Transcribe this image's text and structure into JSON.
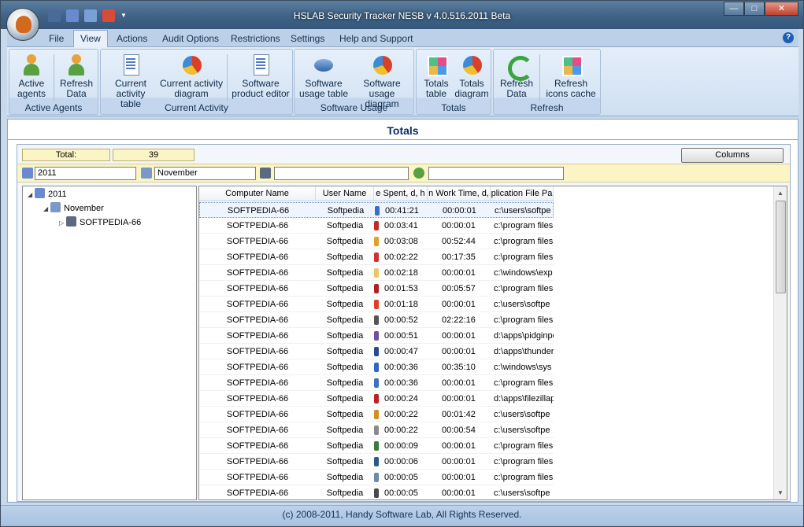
{
  "window": {
    "title": "HSLAB Security Tracker NESB v 4.0.516.2011 Beta"
  },
  "menu": {
    "tabs": [
      "File",
      "View",
      "Actions",
      "Audit Options",
      "Restrictions",
      "Settings",
      "Help and Support"
    ],
    "active_tab": "View",
    "help_icon": "?"
  },
  "ribbon": {
    "groups": [
      {
        "label": "Active Agents",
        "buttons": [
          {
            "line1": "Active",
            "line2": "agents",
            "icon": "agents-icon"
          },
          {
            "line1": "Refresh",
            "line2": "Data",
            "icon": "refresh-agents-icon"
          }
        ]
      },
      {
        "label": "Current Activity",
        "buttons": [
          {
            "line1": "Current",
            "line2": "activity table",
            "icon": "activity-table-icon"
          },
          {
            "line1": "Current activity",
            "line2": "diagram",
            "icon": "activity-diagram-icon"
          },
          {
            "line1": "Software",
            "line2": "product editor",
            "icon": "product-editor-icon"
          }
        ]
      },
      {
        "label": "Software Usage",
        "buttons": [
          {
            "line1": "Software",
            "line2": "usage table",
            "icon": "usage-table-icon"
          },
          {
            "line1": "Software",
            "line2": "usage diagram",
            "icon": "usage-diagram-icon"
          }
        ]
      },
      {
        "label": "Totals",
        "buttons": [
          {
            "line1": "Totals",
            "line2": "table",
            "icon": "totals-table-icon"
          },
          {
            "line1": "Totals",
            "line2": "diagram",
            "icon": "totals-diagram-icon"
          }
        ]
      },
      {
        "label": "Refresh",
        "buttons": [
          {
            "line1": "Refresh",
            "line2": "Data",
            "icon": "refresh-data-icon"
          },
          {
            "line1": "Refresh",
            "line2": "icons cache",
            "icon": "icons-cache-icon"
          }
        ]
      }
    ]
  },
  "totals": {
    "section_title": "Totals",
    "total_label": "Total:",
    "total_value": "39",
    "columns_button": "Columns",
    "filters": {
      "year": "2011",
      "month": "November",
      "computer": "",
      "user": ""
    }
  },
  "tree": {
    "nodes": [
      {
        "label": "2011",
        "icon": "year-icon"
      },
      {
        "label": "November",
        "icon": "month-icon"
      },
      {
        "label": "SOFTPEDIA-66",
        "icon": "computer-icon"
      }
    ]
  },
  "table": {
    "columns": [
      "Computer Name",
      "User Name",
      "e Spent, d, h",
      "n Work Time, d,",
      "plication File Pa"
    ],
    "rows": [
      {
        "computer": "SOFTPEDIA-66",
        "user": "Softpedia",
        "spent": "00:41:21",
        "work": "00:00:01",
        "path": "c:\\users\\softpe",
        "color": "#3c6fc4"
      },
      {
        "computer": "SOFTPEDIA-66",
        "user": "Softpedia",
        "spent": "00:03:41",
        "work": "00:00:01",
        "path": "c:\\program files",
        "color": "#c42a2a"
      },
      {
        "computer": "SOFTPEDIA-66",
        "user": "Softpedia",
        "spent": "00:03:08",
        "work": "00:52:44",
        "path": "c:\\program files",
        "color": "#e0a020"
      },
      {
        "computer": "SOFTPEDIA-66",
        "user": "Softpedia",
        "spent": "00:02:22",
        "work": "00:17:35",
        "path": "c:\\program files",
        "color": "#d03030"
      },
      {
        "computer": "SOFTPEDIA-66",
        "user": "Softpedia",
        "spent": "00:02:18",
        "work": "00:00:01",
        "path": "c:\\windows\\exp",
        "color": "#e8c860"
      },
      {
        "computer": "SOFTPEDIA-66",
        "user": "Softpedia",
        "spent": "00:01:53",
        "work": "00:05:57",
        "path": "c:\\program files",
        "color": "#b02020"
      },
      {
        "computer": "SOFTPEDIA-66",
        "user": "Softpedia",
        "spent": "00:01:18",
        "work": "00:00:01",
        "path": "c:\\users\\softpe",
        "color": "#e04020"
      },
      {
        "computer": "SOFTPEDIA-66",
        "user": "Softpedia",
        "spent": "00:00:52",
        "work": "02:22:16",
        "path": "c:\\program files",
        "color": "#555555"
      },
      {
        "computer": "SOFTPEDIA-66",
        "user": "Softpedia",
        "spent": "00:00:51",
        "work": "00:00:01",
        "path": "d:\\apps\\pidginpo",
        "color": "#7050a0"
      },
      {
        "computer": "SOFTPEDIA-66",
        "user": "Softpedia",
        "spent": "00:00:47",
        "work": "00:00:01",
        "path": "d:\\apps\\thunder",
        "color": "#2a4a90"
      },
      {
        "computer": "SOFTPEDIA-66",
        "user": "Softpedia",
        "spent": "00:00:36",
        "work": "00:35:10",
        "path": "c:\\windows\\sys",
        "color": "#2a6ac0"
      },
      {
        "computer": "SOFTPEDIA-66",
        "user": "Softpedia",
        "spent": "00:00:36",
        "work": "00:00:01",
        "path": "c:\\program files",
        "color": "#4070c0"
      },
      {
        "computer": "SOFTPEDIA-66",
        "user": "Softpedia",
        "spent": "00:00:24",
        "work": "00:00:01",
        "path": "d:\\apps\\filezillap",
        "color": "#c02020"
      },
      {
        "computer": "SOFTPEDIA-66",
        "user": "Softpedia",
        "spent": "00:00:22",
        "work": "00:01:42",
        "path": "c:\\users\\softpe",
        "color": "#d09020"
      },
      {
        "computer": "SOFTPEDIA-66",
        "user": "Softpedia",
        "spent": "00:00:22",
        "work": "00:00:54",
        "path": "c:\\users\\softpe",
        "color": "#8a8a8a"
      },
      {
        "computer": "SOFTPEDIA-66",
        "user": "Softpedia",
        "spent": "00:00:09",
        "work": "00:00:01",
        "path": "c:\\program files",
        "color": "#3a7a3a"
      },
      {
        "computer": "SOFTPEDIA-66",
        "user": "Softpedia",
        "spent": "00:00:06",
        "work": "00:00:01",
        "path": "c:\\program files",
        "color": "#2a5a8a"
      },
      {
        "computer": "SOFTPEDIA-66",
        "user": "Softpedia",
        "spent": "00:00:05",
        "work": "00:00:01",
        "path": "c:\\program files",
        "color": "#6a8ab0"
      },
      {
        "computer": "SOFTPEDIA-66",
        "user": "Softpedia",
        "spent": "00:00:05",
        "work": "00:00:01",
        "path": "c:\\users\\softpe",
        "color": "#4a4a4a"
      }
    ]
  },
  "status": {
    "copyright": "(c) 2008-2011, Handy Software Lab, All Rights Reserved."
  }
}
